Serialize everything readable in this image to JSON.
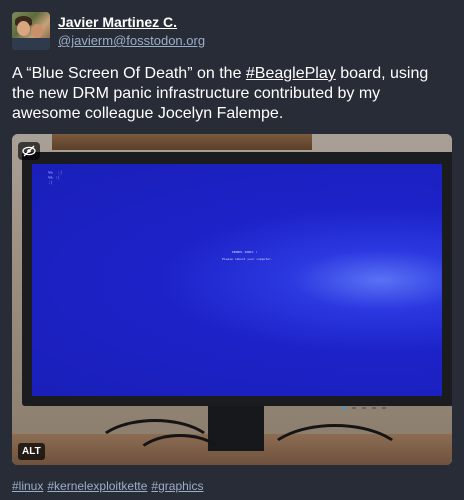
{
  "author": {
    "display_name": "Javier Martinez C.",
    "handle": "@javierm@fosstodon.org"
  },
  "post": {
    "text_before": "A “Blue Screen Of Death” on the ",
    "link_text": "#BeaglePlay",
    "text_after": " board, using the new DRM panic infrastructure contributed by my awesome colleague Jocelyn Falempe."
  },
  "media": {
    "alt_badge": "ALT",
    "visibility_icon": "eye-slash-icon",
    "screen": {
      "corner_text": "%%  :(\n%% :(\n:)",
      "panic_title": "KERNEL PANIC !",
      "panic_message": "Please reboot your computer."
    },
    "colors": {
      "screen_blue": "#1c22c8"
    }
  },
  "hashtags": [
    "#linux",
    "#kernelexploitkette",
    "#graphics"
  ]
}
